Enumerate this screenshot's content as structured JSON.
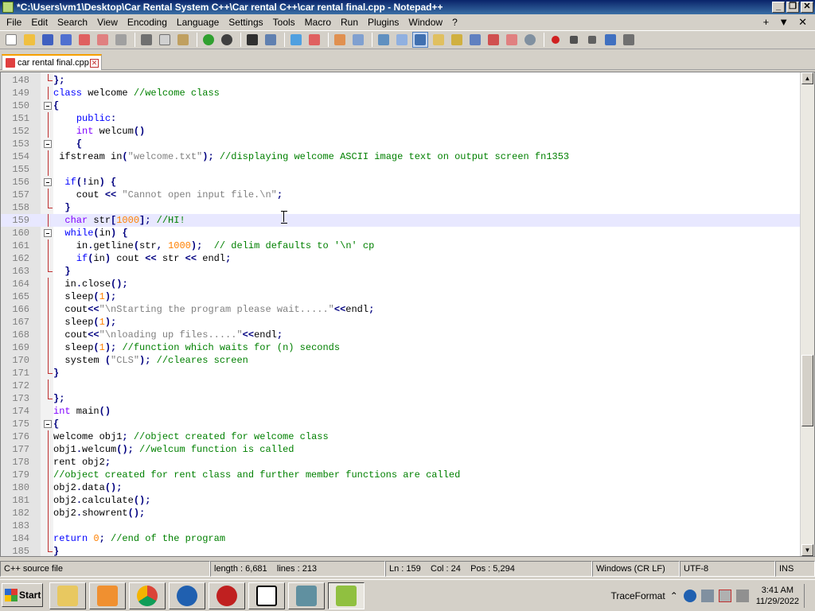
{
  "window": {
    "title": "*C:\\Users\\vm1\\Desktop\\Car Rental System C++\\Car rental C++\\car rental final.cpp - Notepad++"
  },
  "menu": [
    "File",
    "Edit",
    "Search",
    "View",
    "Encoding",
    "Language",
    "Settings",
    "Tools",
    "Macro",
    "Run",
    "Plugins",
    "Window",
    "?"
  ],
  "menu_right": [
    "+",
    "▼",
    "✕"
  ],
  "tab": {
    "label": "car rental final.cpp"
  },
  "editor": {
    "lines": [
      {
        "n": "148",
        "code": "};"
      },
      {
        "n": "149",
        "code": "class welcome //welcome class"
      },
      {
        "n": "150",
        "code": "{"
      },
      {
        "n": "151",
        "code": "    public:"
      },
      {
        "n": "152",
        "code": "    int welcum()"
      },
      {
        "n": "153",
        "code": "    {"
      },
      {
        "n": "154",
        "code": " ifstream in(\"welcome.txt\"); //displaying welcome ASCII image text on output screen fn1353"
      },
      {
        "n": "155",
        "code": ""
      },
      {
        "n": "156",
        "code": "  if(!in) {"
      },
      {
        "n": "157",
        "code": "    cout << \"Cannot open input file.\\n\";"
      },
      {
        "n": "158",
        "code": "  }"
      },
      {
        "n": "159",
        "code": "  char str[1000]; //HI!"
      },
      {
        "n": "160",
        "code": "  while(in) {"
      },
      {
        "n": "161",
        "code": "    in.getline(str, 1000);  // delim defaults to '\\n' cp"
      },
      {
        "n": "162",
        "code": "    if(in) cout << str << endl;"
      },
      {
        "n": "163",
        "code": "  }"
      },
      {
        "n": "164",
        "code": "  in.close();"
      },
      {
        "n": "165",
        "code": "  sleep(1);"
      },
      {
        "n": "166",
        "code": "  cout<<\"\\nStarting the program please wait.....\"<<endl;"
      },
      {
        "n": "167",
        "code": "  sleep(1);"
      },
      {
        "n": "168",
        "code": "  cout<<\"\\nloading up files.....\"<<endl;"
      },
      {
        "n": "169",
        "code": "  sleep(1); //function which waits for (n) seconds"
      },
      {
        "n": "170",
        "code": "  system (\"CLS\"); //cleares screen"
      },
      {
        "n": "171",
        "code": "}"
      },
      {
        "n": "172",
        "code": ""
      },
      {
        "n": "173",
        "code": "};"
      },
      {
        "n": "174",
        "code": "int main()"
      },
      {
        "n": "175",
        "code": "{"
      },
      {
        "n": "176",
        "code": "welcome obj1; //object created for welcome class"
      },
      {
        "n": "177",
        "code": "obj1.welcum(); //welcum function is called"
      },
      {
        "n": "178",
        "code": "rent obj2;"
      },
      {
        "n": "179",
        "code": "//object created for rent class and further member functions are called"
      },
      {
        "n": "180",
        "code": "obj2.data();"
      },
      {
        "n": "181",
        "code": "obj2.calculate();"
      },
      {
        "n": "182",
        "code": "obj2.showrent();"
      },
      {
        "n": "183",
        "code": ""
      },
      {
        "n": "184",
        "code": "return 0; //end of the program"
      },
      {
        "n": "185",
        "code": "}"
      }
    ],
    "current_line": "159"
  },
  "status": {
    "file_type": "C++ source file",
    "length": "length : 6,681",
    "lines": "lines : 213",
    "ln": "Ln : 159",
    "col": "Col : 24",
    "pos": "Pos : 5,294",
    "eol": "Windows (CR LF)",
    "encoding": "UTF-8",
    "mode": "INS"
  },
  "taskbar": {
    "start_label": "Start",
    "tray_label": "TraceFormat",
    "time": "3:41 AM",
    "date": "11/29/2022"
  },
  "colors": {
    "keyword": "#0000ff",
    "type": "#8000ff",
    "comment": "#008000",
    "string": "#808080",
    "number": "#ff8000",
    "fold_marker": "#c03030",
    "current_line_bg": "#e8e8ff"
  }
}
